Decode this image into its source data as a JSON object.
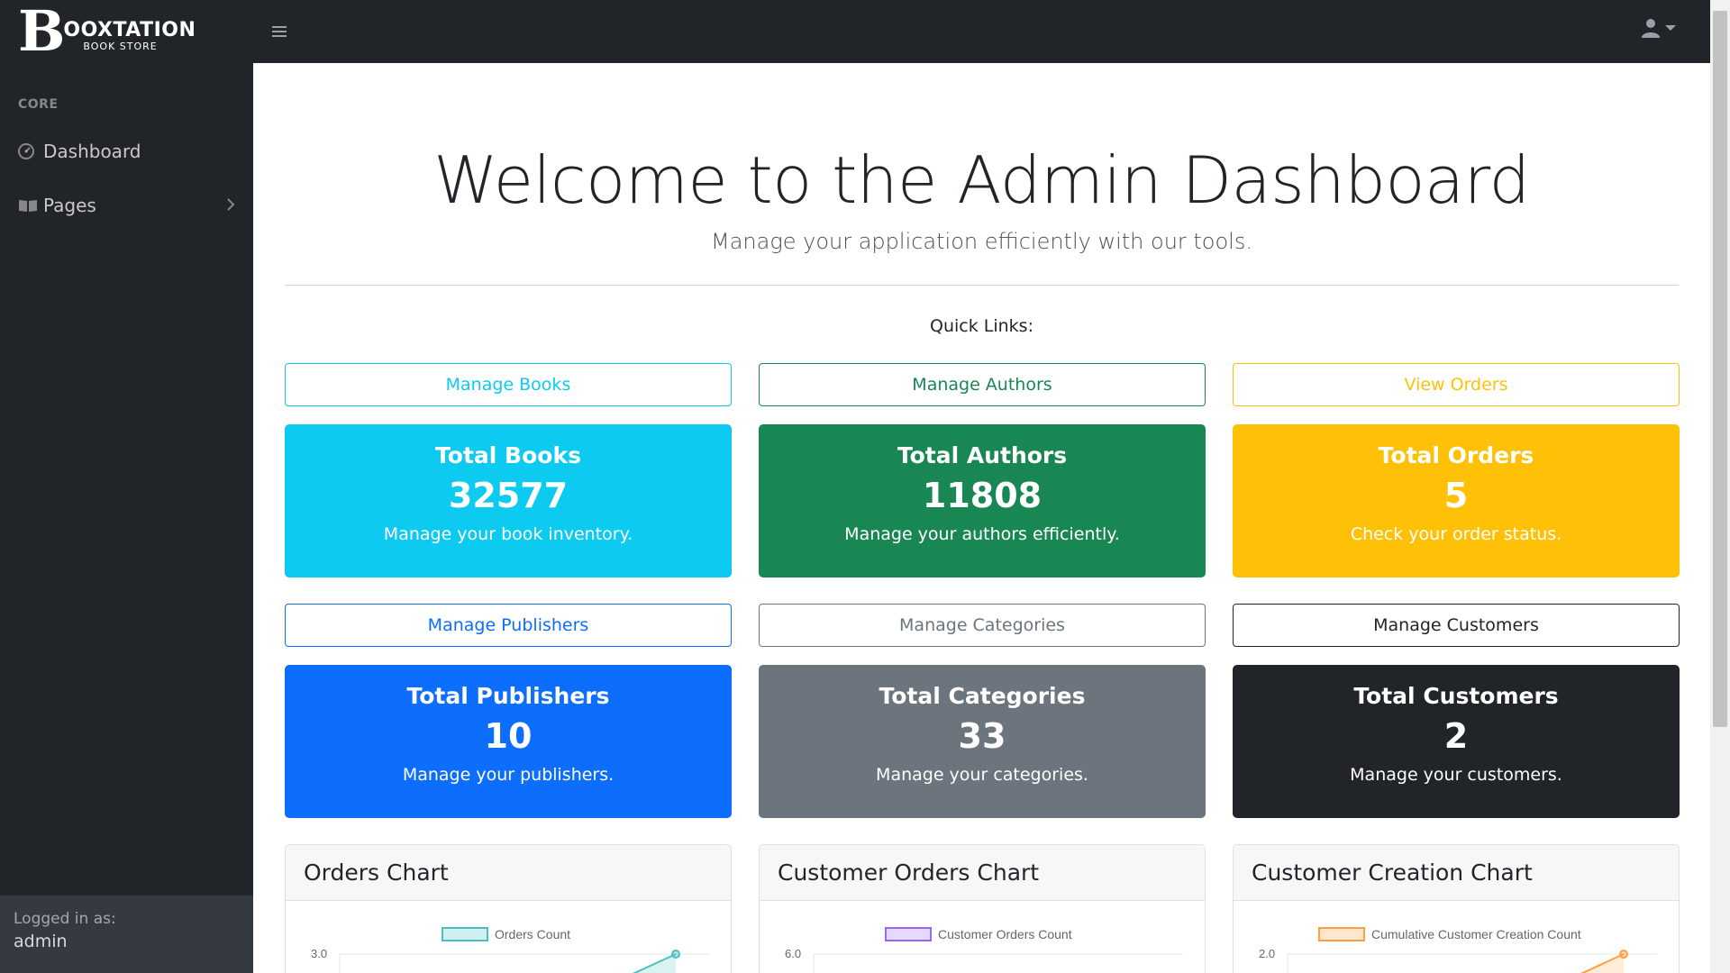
{
  "brand": {
    "letter": "B",
    "name": "OOXTATION",
    "sub": "BOOK STORE"
  },
  "sidebar": {
    "heading": "CORE",
    "items": [
      {
        "label": "Dashboard",
        "icon": "dashboard-icon"
      },
      {
        "label": "Pages",
        "icon": "book-open-icon"
      }
    ],
    "footer": {
      "caption": "Logged in as:",
      "user": "admin"
    }
  },
  "main": {
    "title": "Welcome to the Admin Dashboard",
    "lead": "Manage your application efficiently with our tools.",
    "quick_links": "Quick Links:"
  },
  "colors": {
    "info": "#0dcaf0",
    "success": "#198754",
    "warning": "#ffc107",
    "primary": "#0d6efd",
    "secondary": "#6c757d",
    "dark": "#212529"
  },
  "sections": [
    {
      "button": "Manage Books",
      "button_color": "#0dcaf0",
      "card_color": "#0dcaf0",
      "title": "Total Books",
      "value": "32577",
      "text": "Manage your book inventory."
    },
    {
      "button": "Manage Authors",
      "button_color": "#198754",
      "card_color": "#198754",
      "title": "Total Authors",
      "value": "11808",
      "text": "Manage your authors efficiently."
    },
    {
      "button": "View Orders",
      "button_color": "#ffc107",
      "card_color": "#ffc107",
      "title": "Total Orders",
      "value": "5",
      "text": "Check your order status."
    },
    {
      "button": "Manage Publishers",
      "button_color": "#0d6efd",
      "card_color": "#0d6efd",
      "title": "Total Publishers",
      "value": "10",
      "text": "Manage your publishers."
    },
    {
      "button": "Manage Categories",
      "button_color": "#6c757d",
      "card_color": "#6c757d",
      "title": "Total Categories",
      "value": "33",
      "text": "Manage your categories."
    },
    {
      "button": "Manage Customers",
      "button_color": "#212529",
      "card_color": "#212529",
      "title": "Total Customers",
      "value": "2",
      "text": "Manage your customers."
    }
  ],
  "charts": [
    {
      "title": "Orders Chart",
      "legend": "Orders Count",
      "ytick": "3.0",
      "color": "#4bc0c0"
    },
    {
      "title": "Customer Orders Chart",
      "legend": "Customer Orders Count",
      "ytick": "6.0",
      "color": "#9966ff"
    },
    {
      "title": "Customer Creation Chart",
      "legend": "Cumulative Customer Creation Count",
      "ytick": "2.0",
      "color": "#ff9f40"
    }
  ]
}
